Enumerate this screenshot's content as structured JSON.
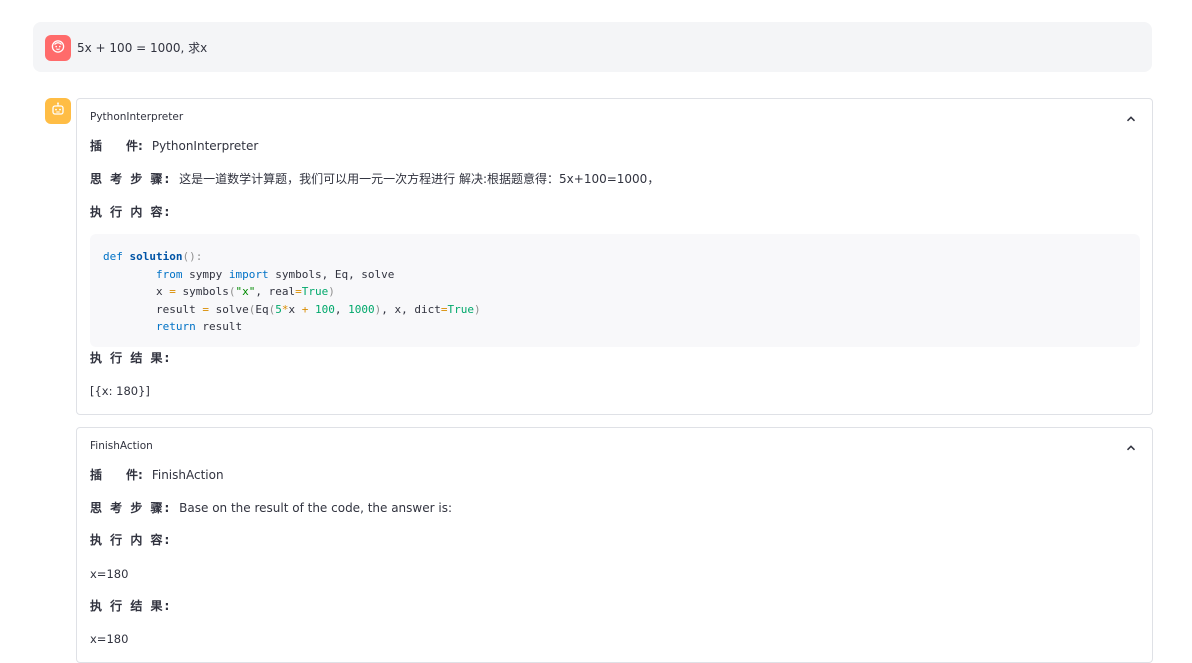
{
  "user_message": {
    "text": "5x + 100 = 1000, 求x"
  },
  "steps": [
    {
      "title": "PythonInterpreter",
      "plugin_label": "插　　件:",
      "plugin_value": "PythonInterpreter",
      "thought_label": "思 考 步 骤:",
      "thought_value": "这是一道数学计算题，我们可以用一元一次方程进行 解决:根据题意得：5x+100=1000，",
      "content_label": "执 行 内 容:",
      "code_lines": [
        "def solution():",
        "        from sympy import symbols, Eq, solve",
        "        x = symbols(\"x\", real=True)",
        "        result = solve(Eq(5*x + 100, 1000), x, dict=True)",
        "        return result"
      ],
      "result_label": "执 行 结 果:",
      "result_value": "[{x: 180}]"
    },
    {
      "title": "FinishAction",
      "plugin_label": "插　　件:",
      "plugin_value": "FinishAction",
      "thought_label": "思 考 步 骤:",
      "thought_value": "Base on the result of the code, the answer is:",
      "content_label": "执 行 内 容:",
      "content_value": "x=180",
      "result_label": "执 行 结 果:",
      "result_value": "x=180"
    }
  ],
  "icons": {
    "user_avatar": "face-icon",
    "bot_avatar": "robot-icon",
    "collapse": "chevron-up-icon"
  },
  "colors": {
    "user_avatar_bg": "#ff6b6b",
    "bot_avatar_bg": "#ffbd45"
  }
}
